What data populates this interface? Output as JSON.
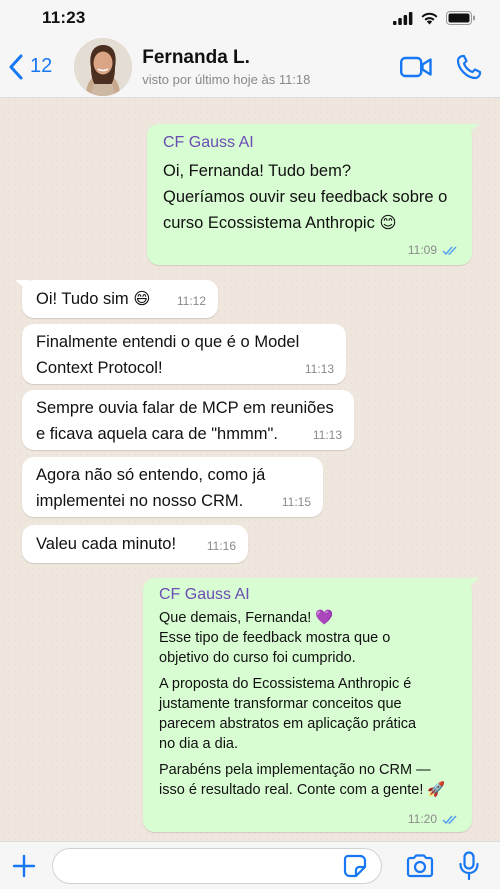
{
  "status_bar": {
    "time": "11:23"
  },
  "header": {
    "back_count": "12",
    "contact_name": "Fernanda L.",
    "last_seen": "visto por último hoje às 11:18"
  },
  "messages": [
    {
      "direction": "out",
      "sender": "CF Gauss AI",
      "lines": [
        "Oi, Fernanda! Tudo bem?",
        "Queríamos ouvir seu feedback sobre o",
        "curso Ecossistema Anthropic 😊"
      ],
      "time": "11:09",
      "status_icon": "double-check-icon"
    },
    {
      "direction": "in",
      "lines": [
        "Oi! Tudo sim 😄"
      ],
      "time": "11:12"
    },
    {
      "direction": "in",
      "lines": [
        "Finalmente entendi o que é o Model",
        "Context Protocol!"
      ],
      "time": "11:13"
    },
    {
      "direction": "in",
      "lines": [
        "Sempre ouvia falar de MCP em reuniões",
        "e ficava aquela cara de \"hmmm\"."
      ],
      "time": "11:13"
    },
    {
      "direction": "in",
      "lines": [
        "Agora não só entendo, como já",
        "implementei no nosso CRM."
      ],
      "time": "11:15"
    },
    {
      "direction": "in",
      "lines": [
        "Valeu cada minuto!"
      ],
      "time": "11:16"
    },
    {
      "direction": "out",
      "sender": "CF Gauss AI",
      "paragraphs": [
        [
          "Que demais, Fernanda! 💜",
          "Esse tipo de feedback mostra que o",
          "objetivo do curso foi cumprido."
        ],
        [
          "A proposta do Ecossistema Anthropic é",
          "justamente transformar conceitos que",
          "parecem abstratos em aplicação prática",
          "no dia a dia."
        ],
        [
          "Parabéns pela implementação no CRM —",
          "isso é resultado real. Conte com a gente! 🚀"
        ]
      ],
      "time": "11:20",
      "status_icon": "double-check-icon"
    }
  ],
  "input": {
    "placeholder": "",
    "value": ""
  },
  "colors": {
    "accent": "#1877f2",
    "outgoing_bubble": "#d9fdd3",
    "incoming_bubble": "#ffffff",
    "sender_name": "#6a4db3",
    "chat_background": "#efe7dd",
    "read_ticks": "#4f9df2"
  },
  "icons": [
    "back-chevron-icon",
    "video-call-icon",
    "phone-icon",
    "plus-icon",
    "sticker-icon",
    "camera-icon",
    "microphone-icon",
    "signal-icon",
    "wifi-icon",
    "battery-icon"
  ]
}
